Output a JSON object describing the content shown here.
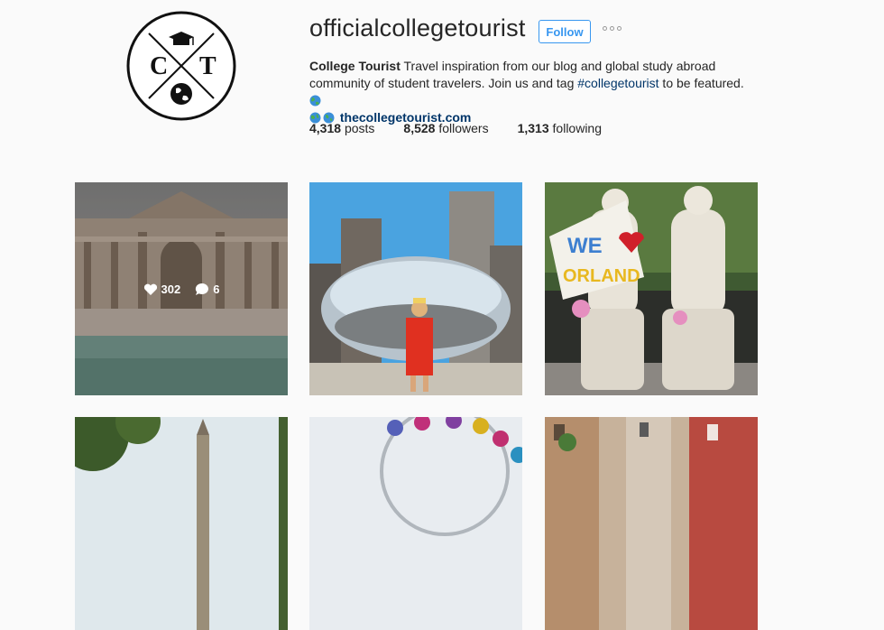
{
  "profile": {
    "username": "officialcollegetourist",
    "follow_label": "Follow",
    "logo_letters": [
      "C",
      "T"
    ],
    "bio_name": "College Tourist",
    "bio_text_1": " Travel inspiration from our blog and global study abroad community of student travelers. Join us and tag ",
    "bio_hashtag": "#collegetourist",
    "bio_text_2": " to be featured. ",
    "website": "thecollegetourist.com"
  },
  "stats": {
    "posts_count": "4,318",
    "posts_label": "posts",
    "followers_count": "8,528",
    "followers_label": "followers",
    "following_count": "1,313",
    "following_label": "following"
  },
  "posts": [
    {
      "name": "trevi-fountain",
      "likes": "302",
      "comments": "6"
    },
    {
      "name": "chicago-bean"
    },
    {
      "name": "statues-we-love-orlando"
    },
    {
      "name": "clock-tower"
    },
    {
      "name": "ferris-wheel"
    },
    {
      "name": "city-street"
    }
  ],
  "colors": {
    "accent": "#3897f0",
    "link": "#003569",
    "text": "#262626",
    "background": "#fafafa"
  }
}
